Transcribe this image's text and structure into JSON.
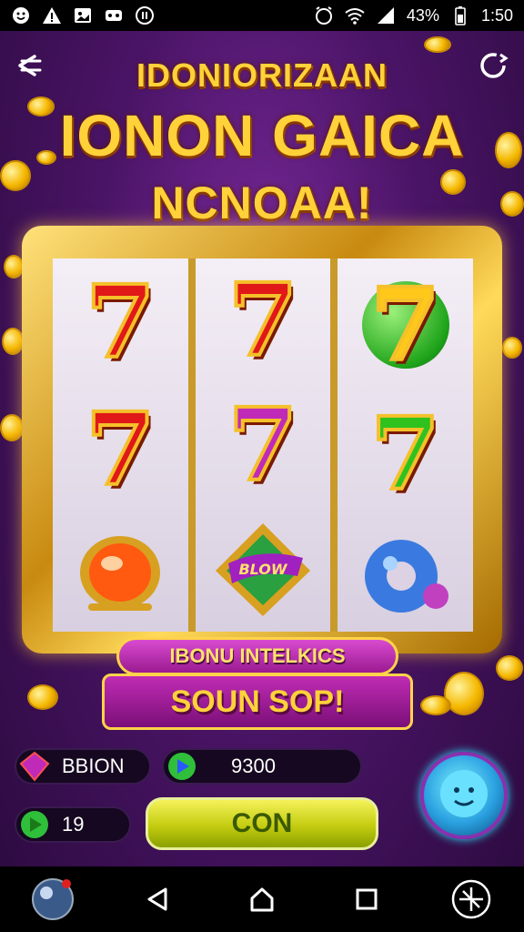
{
  "status_bar": {
    "battery_text": "43%",
    "time": "1:50"
  },
  "header": {
    "title_line1": "IDONIORIZAAN",
    "title_line2": "IONON GAICA",
    "title_line3": "NCNOAA!"
  },
  "reels": [
    [
      "red-seven",
      "red-seven",
      "orange-gem"
    ],
    [
      "red-seven",
      "pink-seven",
      "purple-bonus-emblem"
    ],
    [
      "yellow-seven-on-green-ball",
      "green-seven",
      "blue-ring"
    ]
  ],
  "reel_glyph": "7",
  "emblem_text": "BLOW",
  "bonus_banner": "IBONU INTELKICS",
  "spin_button": "SOUN SOP!",
  "balances": {
    "gems_label": "BBION",
    "coins_value": "9300",
    "level_value": "19"
  },
  "action_button": "CON",
  "colors": {
    "title_gold": "#ffd23a",
    "frame_gold": "#c88a10",
    "banner_magenta": "#9a1a90",
    "action_yellow": "#c4cc10",
    "background_purple": "#4a1466"
  }
}
